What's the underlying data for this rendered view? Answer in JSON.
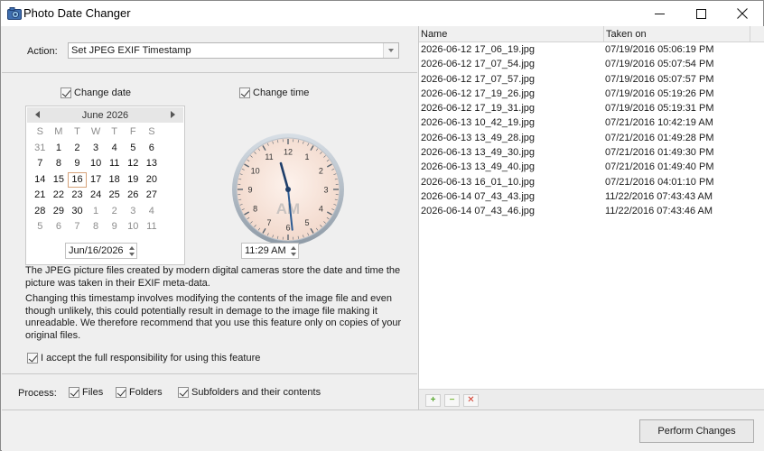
{
  "window": {
    "title": "Photo Date Changer",
    "app_icon": "photo-camera-icon",
    "controls": [
      "minimize-icon",
      "maximize-icon",
      "close-icon"
    ]
  },
  "action": {
    "label": "Action:",
    "value": "Set JPEG EXIF Timestamp"
  },
  "change_date": {
    "label": "Change date",
    "checked": true
  },
  "change_time": {
    "label": "Change time",
    "checked": true
  },
  "calendar": {
    "month_title": "June 2026",
    "weekdays": [
      "S",
      "M",
      "T",
      "W",
      "T",
      "F",
      "S"
    ],
    "days": [
      [
        "31",
        "1",
        "2",
        "3",
        "4",
        "5",
        "6"
      ],
      [
        "7",
        "8",
        "9",
        "10",
        "11",
        "12",
        "13"
      ],
      [
        "14",
        "15",
        "16",
        "17",
        "18",
        "19",
        "20"
      ],
      [
        "21",
        "22",
        "23",
        "24",
        "25",
        "26",
        "27"
      ],
      [
        "28",
        "29",
        "30",
        "1",
        "2",
        "3",
        "4"
      ],
      [
        "5",
        "6",
        "7",
        "8",
        "9",
        "10",
        "11"
      ]
    ],
    "selected_day": "16"
  },
  "clock": {
    "numbers": [
      "12",
      "1",
      "2",
      "3",
      "4",
      "5",
      "6",
      "7",
      "8",
      "9",
      "10",
      "11"
    ],
    "ampm": "AM",
    "hour": 11,
    "minute": 29
  },
  "date_value": "Jun/16/2026",
  "time_value": "11:29 AM",
  "description": {
    "p1": "The JPEG picture files created by modern digital cameras store the date and time the picture was taken in their EXIF meta-data.",
    "p2": "Changing this timestamp involves modifying the contents of the image file and even though unlikely, this could potentially result in demage to the image file making it unreadable. We therefore recommend that you use this feature only on copies of your original files."
  },
  "accept": {
    "label": "I accept the full responsibility for using this feature",
    "checked": true
  },
  "process": {
    "label": "Process:",
    "files": "Files",
    "folders": "Folders",
    "subfolders": "Subfolders and their contents"
  },
  "file_list": {
    "columns": [
      "Name",
      "Taken on"
    ],
    "rows": [
      [
        "2026-06-12 17_06_19.jpg",
        "07/19/2016 05:06:19 PM"
      ],
      [
        "2026-06-12 17_07_54.jpg",
        "07/19/2016 05:07:54 PM"
      ],
      [
        "2026-06-12 17_07_57.jpg",
        "07/19/2016 05:07:57 PM"
      ],
      [
        "2026-06-12 17_19_26.jpg",
        "07/19/2016 05:19:26 PM"
      ],
      [
        "2026-06-12 17_19_31.jpg",
        "07/19/2016 05:19:31 PM"
      ],
      [
        "2026-06-13 10_42_19.jpg",
        "07/21/2016 10:42:19 AM"
      ],
      [
        "2026-06-13 13_49_28.jpg",
        "07/21/2016 01:49:28 PM"
      ],
      [
        "2026-06-13 13_49_30.jpg",
        "07/21/2016 01:49:30 PM"
      ],
      [
        "2026-06-13 13_49_40.jpg",
        "07/21/2016 01:49:40 PM"
      ],
      [
        "2026-06-13 16_01_10.jpg",
        "07/21/2016 04:01:10 PM"
      ],
      [
        "2026-06-14 07_43_43.jpg",
        "11/22/2016 07:43:43 AM"
      ],
      [
        "2026-06-14 07_43_46.jpg",
        "11/22/2016 07:43:46 AM"
      ]
    ],
    "toolbar": [
      {
        "icon": "add-icon",
        "glyph": "+",
        "color": "#5aa832"
      },
      {
        "icon": "remove-icon",
        "glyph": "−",
        "color": "#7cba3c"
      },
      {
        "icon": "clear-icon",
        "glyph": "✕",
        "color": "#d23a2a"
      }
    ]
  },
  "perform_label": "Perform Changes"
}
